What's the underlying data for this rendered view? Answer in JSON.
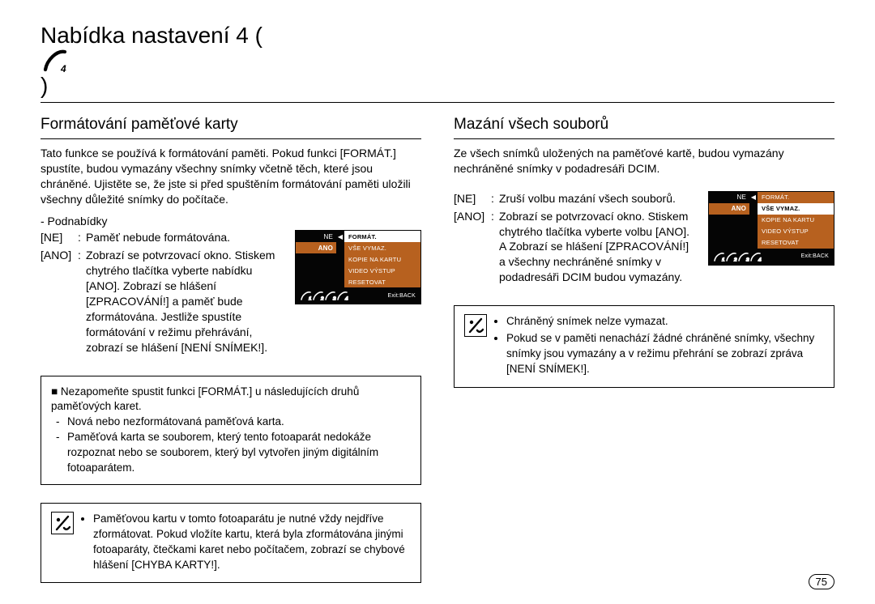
{
  "header": {
    "title_prefix": "Nabídka nastavení 4 (",
    "title_suffix": ")"
  },
  "left": {
    "subhead": "Formátování paměťové karty",
    "intro": "Tato funkce se používá k formátování paměti. Pokud funkci [FORMÁT.] spustíte, budou vymazány všechny snímky včetně těch, které jsou chráněné. Ujistěte se, že jste si před spuštěním formátování paměti uložili všechny důležité snímky do počítače.",
    "submenus": "- Podnabídky",
    "options": [
      {
        "key": "[NE]",
        "val": "Paměť nebude formátována."
      },
      {
        "key": "[ANO]",
        "val": "Zobrazí se potvrzovací okno. Stiskem chytrého tlačítka vyberte nabídku [ANO]. Zobrazí se hlášení [ZPRACOVÁNÍ!] a paměť bude zformátována. Jestliže spustíte formátování v režimu přehrávání, zobrazí se hlášení [NENÍ SNÍMEK!]."
      }
    ],
    "note_lead": "■ Nezapomeňte spustit funkci [FORMÁT.] u následujících druhů paměťových karet.",
    "note_items": [
      "Nová nebo nezformátovaná paměťová karta.",
      "Paměťová karta se souborem, který tento fotoaparát nedokáže rozpoznat nebo se souborem, který byl vytvořen jiným digitálním fotoaparátem."
    ],
    "tip_items": [
      "Paměťovou kartu v tomto fotoaparátu je nutné vždy nejdříve zformátovat. Pokud vložíte kartu, která byla zformátována jinými fotoaparáty, čtečkami karet nebo počítačem, zobrazí se chybové hlášení [CHYBA KARTY!]."
    ]
  },
  "right": {
    "subhead": "Mazání všech souborů",
    "intro": "Ze všech snímků uložených na paměťové kartě, budou vymazány nechráněné snímky v podadresáři DCIM.",
    "options": [
      {
        "key": "[NE]",
        "val": "Zruší volbu mazání všech souborů."
      },
      {
        "key": "[ANO]",
        "val": "Zobrazí se potvrzovací okno. Stiskem chytrého tlačítka vyberte volbu [ANO]. A Zobrazí se hlášení [ZPRACOVÁNÍ!] a všechny nechráněné snímky v podadresáři DCIM budou vymazány."
      }
    ],
    "tip_items": [
      "Chráněný snímek nelze vymazat.",
      "Pokud se v paměti nenachází žádné chráněné snímky, všechny snímky jsou vymazány a v režimu přehrání se zobrazí zpráva [NENÍ SNÍMEK!]."
    ]
  },
  "lcd": {
    "left_ne": "NE",
    "left_ano": "ANO",
    "items": [
      "FORMÁT.",
      "VŠE VYMAZ.",
      "KOPIE NA KARTU",
      "VIDEO VÝSTUP",
      "RESETOVAT"
    ],
    "exit": "Exit:BACK"
  },
  "page_number": "75"
}
